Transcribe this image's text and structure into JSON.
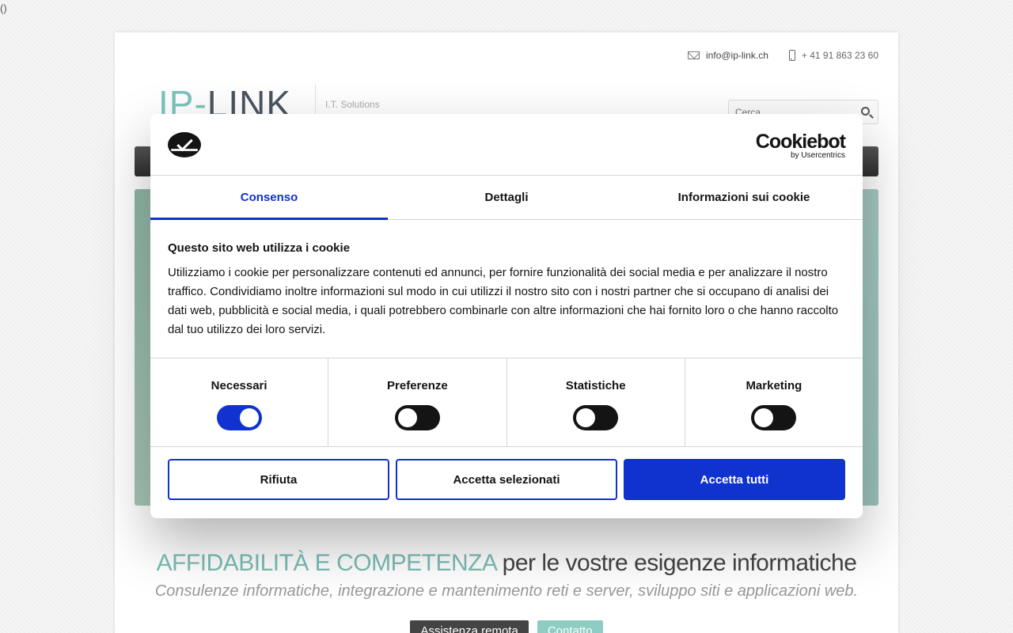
{
  "corner_text": "()",
  "site": {
    "email": "info@ip-link.ch",
    "phone": "+ 41 91 863 23 60",
    "logo_prefix": "IP-",
    "logo_main": "LINK",
    "tagline": "I.T. Solutions",
    "search_placeholder": "Cerca",
    "headline_accent": "AFFIDABILITÀ E COMPETENZA",
    "headline_rest": " per le vostre esigenze informatiche",
    "subheadline": "Consulenze informatiche, integrazione e mantenimento reti e server, sviluppo siti e applicazioni web.",
    "buttons": {
      "remote": "Assistenza remota",
      "contact": "Contatto"
    }
  },
  "cookie_dialog": {
    "brand_name": "Cookiebot",
    "brand_sub": "by Usercentrics",
    "tabs": [
      {
        "label": "Consenso",
        "active": true
      },
      {
        "label": "Dettagli",
        "active": false
      },
      {
        "label": "Informazioni sui cookie",
        "active": false
      }
    ],
    "title": "Questo sito web utilizza i cookie",
    "text": "Utilizziamo i cookie per personalizzare contenuti ed annunci, per fornire funzionalità dei social media e per analizzare il nostro traffico. Condividiamo inoltre informazioni sul modo in cui utilizzi il nostro sito con i nostri partner che si occupano di analisi dei dati web, pubblicità e social media, i quali potrebbero combinarle con altre informazioni che hai fornito loro o che hanno raccolto dal tuo utilizzo dei loro servizi.",
    "toggles": [
      {
        "label": "Necessari",
        "on": true
      },
      {
        "label": "Preferenze",
        "on": false
      },
      {
        "label": "Statistiche",
        "on": false
      },
      {
        "label": "Marketing",
        "on": false
      }
    ],
    "buttons": {
      "reject": "Rifiuta",
      "accept_selected": "Accetta selezionati",
      "accept_all": "Accetta tutti"
    }
  },
  "colors": {
    "accent_blue": "#1032cf",
    "brand_teal": "#7bbdb5"
  },
  "icons": {
    "mail": "mail-icon",
    "phone": "phone-icon",
    "search": "search-icon",
    "cookiebot": "cookiebot-logo-icon"
  }
}
